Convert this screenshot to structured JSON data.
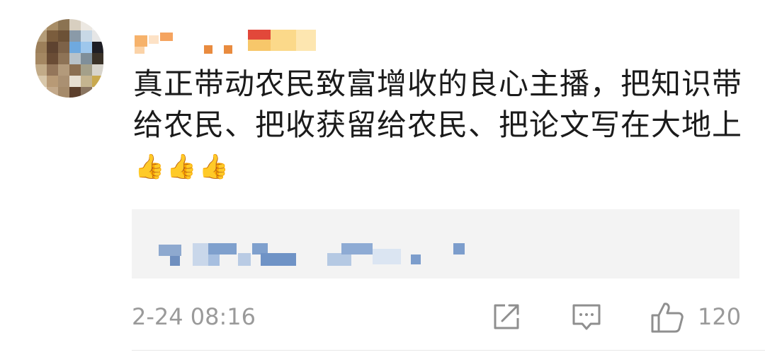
{
  "comment": {
    "text": "真正带动农民致富增收的良心主播，把知识带给农民、把收获留给农民、把论文写在大地上",
    "emoji": [
      "👍",
      "👍",
      "👍"
    ]
  },
  "footer": {
    "timestamp": "2-24 08:16",
    "like_count": "120"
  },
  "icons": {
    "share": "share-icon",
    "reply": "comment-icon",
    "like": "thumbs-up-icon"
  }
}
